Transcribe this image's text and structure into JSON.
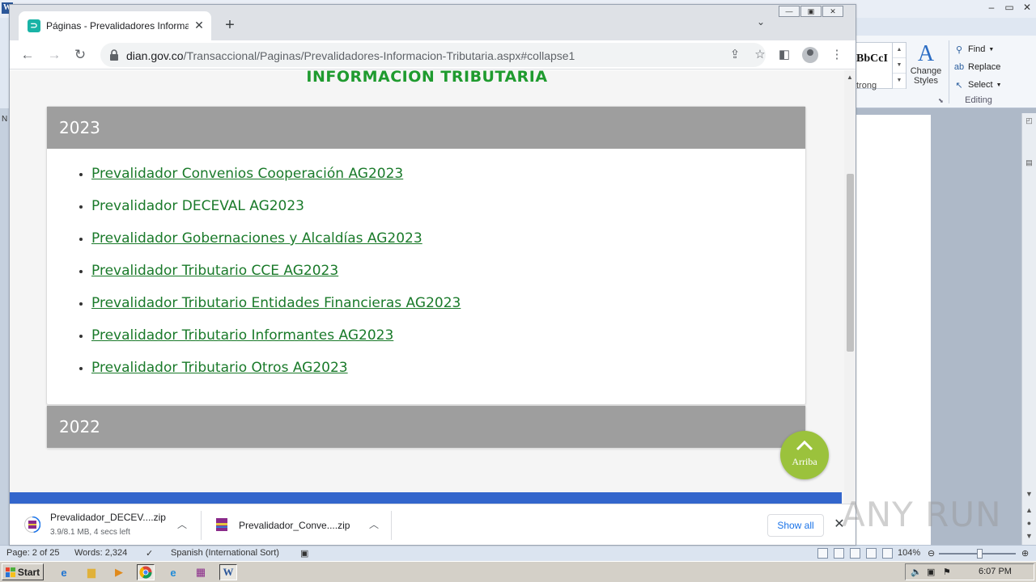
{
  "word": {
    "styles_preview": "BbCcI",
    "styles_label": "trong",
    "change_styles": "Change Styles",
    "find": "Find",
    "replace": "Replace",
    "select": "Select",
    "editing_group": "Editing",
    "status": {
      "page": "Page: 2 of 25",
      "words": "Words: 2,324",
      "language": "Spanish (International Sort)",
      "zoom": "104%"
    }
  },
  "browser": {
    "tab_title": "Páginas - Prevalidadores Informacion",
    "url_host": "dian.gov.co",
    "url_path": "/Transaccional/Paginas/Prevalidadores-Informacion-Tributaria.aspx#collapse1"
  },
  "page": {
    "heading": "INFORMACION TRIBUTARIA",
    "panels": [
      {
        "year": "2023",
        "items": [
          "Prevalidador Convenios Cooperación AG2023",
          "Prevalidador DECEVAL AG2023",
          "Prevalidador Gobernaciones y Alcaldías AG2023",
          "Prevalidador Tributario CCE AG2023",
          "Prevalidador Tributario Entidades Financieras AG2023",
          "Prevalidador Tributario Informantes AG2023",
          "Prevalidador Tributario Otros AG2023"
        ]
      },
      {
        "year": "2022"
      }
    ],
    "back_to_top": "Arriba"
  },
  "downloads": {
    "items": [
      {
        "name": "Prevalidador_DECEV....zip",
        "status": "3.9/8.1 MB, 4 secs left"
      },
      {
        "name": "Prevalidador_Conve....zip",
        "status": ""
      }
    ],
    "show_all": "Show all"
  },
  "taskbar": {
    "start": "Start",
    "clock": "6:07 PM"
  },
  "watermark": "ANY RUN",
  "colors": {
    "heading_green": "#1f9b2f",
    "link_green": "#1a7a2a",
    "panel_gray": "#9e9e9e",
    "arriba_green": "#9bc23c",
    "footer_blue": "#3366cc"
  }
}
